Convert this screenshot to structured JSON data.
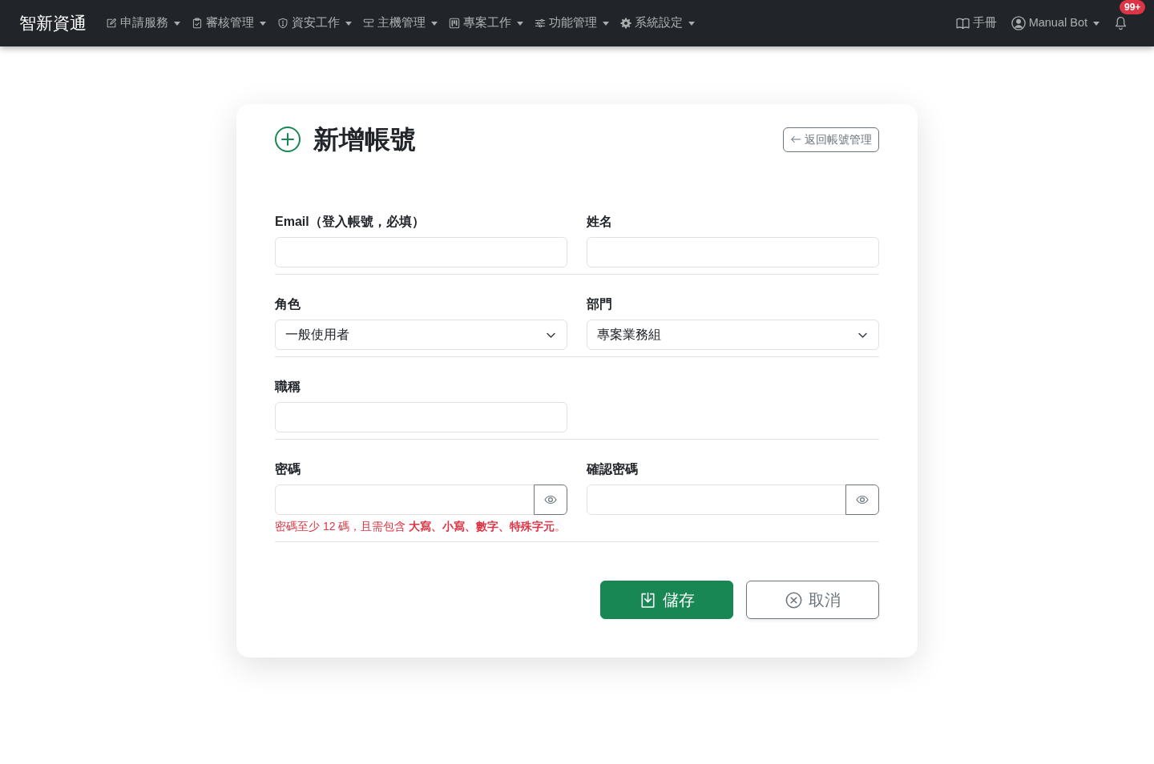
{
  "navbar": {
    "brand": "智新資通",
    "menus": [
      {
        "label": "申請服務",
        "dropdown": true
      },
      {
        "label": "審核管理",
        "dropdown": true
      },
      {
        "label": "資安工作",
        "dropdown": true
      },
      {
        "label": "主機管理",
        "dropdown": true
      },
      {
        "label": "專案工作",
        "dropdown": true
      },
      {
        "label": "功能管理",
        "dropdown": true
      },
      {
        "label": "系統設定",
        "dropdown": true
      }
    ],
    "manual": {
      "label": "手冊"
    },
    "user": {
      "name": "Manual Bot",
      "dropdown": true
    },
    "notifications": {
      "badge": "99+"
    }
  },
  "page": {
    "title": "新增帳號",
    "back_button": "返回帳號管理"
  },
  "form": {
    "sections": [
      {
        "fields": [
          {
            "kind": "text",
            "label": "Email（登入帳號，必填）"
          },
          {
            "kind": "text",
            "label": "姓名"
          }
        ]
      },
      {
        "fields": [
          {
            "kind": "select",
            "label": "角色",
            "value": "一般使用者"
          },
          {
            "kind": "select",
            "label": "部門",
            "value": "專案業務組"
          }
        ]
      },
      {
        "fields": [
          {
            "kind": "text",
            "label": "職稱"
          }
        ]
      },
      {
        "fields": [
          {
            "kind": "password",
            "label": "密碼",
            "help": "密碼至少 12 碼，且需包含 **大寫、小寫、數字、特殊字元**。"
          },
          {
            "kind": "password",
            "label": "確認密碼"
          }
        ]
      }
    ]
  },
  "actions": [
    {
      "kind": "save",
      "label": "儲存"
    },
    {
      "kind": "cancel",
      "label": "取消"
    }
  ]
}
